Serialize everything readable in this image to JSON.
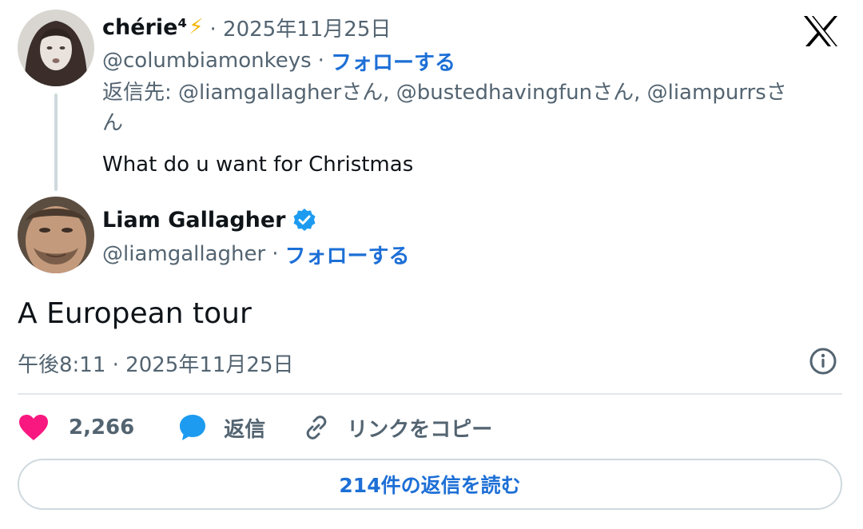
{
  "reply_tweet": {
    "display_name": "chérie⁴",
    "name_emoji": "⚡",
    "date": "· 2025年11月25日",
    "handle": "@columbiamonkeys",
    "separator": "·",
    "follow_label": "フォローする",
    "reply_to_line1": "返信先: @liamgallagherさん, @bustedhavingfunさん, @liampurrsさ",
    "reply_to_line2": "ん",
    "text": "What do u want for Christmas"
  },
  "main_tweet": {
    "display_name": "Liam Gallagher",
    "verified_icon": "verified-badge-icon",
    "handle": "@liamgallagher",
    "separator": "·",
    "follow_label": "フォローする",
    "text": "A European tour",
    "timestamp": "午後8:11 · 2025年11月25日"
  },
  "actions": {
    "like_count": "2,266",
    "reply_label": "返信",
    "copy_link_label": "リンクをコピー"
  },
  "read_replies_label": "214件の返信を読む",
  "colors": {
    "like": "#f91880",
    "reply": "#1d9bf0",
    "follow": "#1d6fd6",
    "muted": "#536471",
    "verified": "#1d9bf0"
  },
  "icons": {
    "brand": "x-logo-icon",
    "info": "info-icon",
    "like": "heart-icon",
    "reply": "speech-bubble-icon",
    "copy_link": "link-icon"
  }
}
